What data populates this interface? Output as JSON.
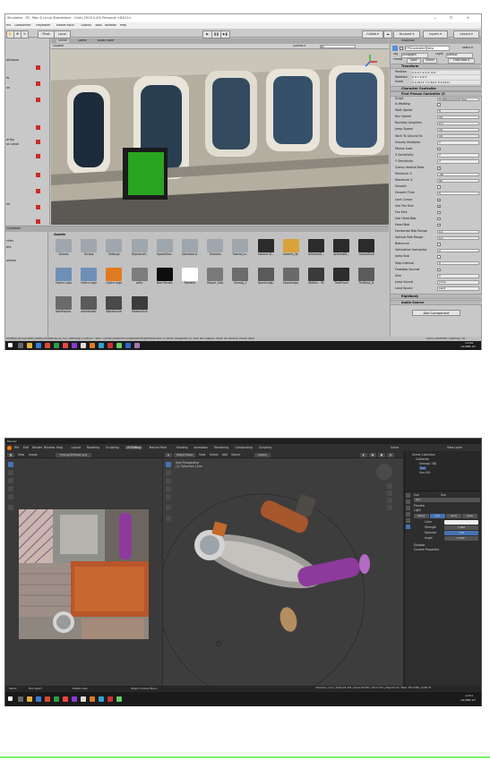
{
  "unity": {
    "title": "Simulator - PC, Mac & Linux Standalone - Unity 2019.2.4f1 Personal <DX11>",
    "window_controls": [
      "—",
      "☐",
      "✕"
    ],
    "menu": [
      "ect",
      "Component",
      "PlayMaker",
      "Mobile Input",
      "Tutorial",
      "Tools",
      "Window",
      "Help"
    ],
    "toolbar": {
      "pivot": "Pivot",
      "local": "Local",
      "collab": "Collab ▾",
      "account": "Account ▾",
      "layers": "Layers ▾",
      "layout": "Layout ▾"
    },
    "hierarchy": {
      "items": [
        "ellowpe",
        "ts",
        "ss",
        "erlay",
        "ss Level",
        "ne"
      ],
      "badge": "F"
    },
    "scene": {
      "tabs": [
        "Scene",
        "Game",
        "Asset Store"
      ],
      "shading": "Shaded",
      "gizmos": "Gizmos ▾",
      "search": "All"
    },
    "project": {
      "tab_left": "PlayMaker",
      "tree": [
        "rites",
        "ets",
        "utions"
      ],
      "header": "Assets",
      "assets_row1": [
        "Scenes",
        "Scripts",
        "Settings",
        "ShipsAndS...",
        "SpaceShac...",
        "Standard A...",
        "Textures",
        "Tutorial_In...",
        "Artemis B...",
        "Artemis_W...",
        "ArtemisSt...",
        "ArtemisSt...",
        "CockpitCall..."
      ],
      "assets_row2": [
        "Hydra Logo",
        "Hydra Logo...",
        "Hydra Logo...",
        "Lefty",
        "New Rende...",
        "Readme",
        "Repair_Stat...",
        "Smoog_1",
        "SpaceLega...",
        "SpaceLega...",
        "Station - St...",
        "TaskFluxx",
        "TheBoss_B..."
      ],
      "assets_row3": [
        "warehouse...",
        "warehouse...",
        "WarehouseD...",
        "ZeldersVizV"
      ]
    },
    "inspector": {
      "tab": "Inspector",
      "object_name": "FPSController@ship",
      "static": "Static ▾",
      "tag_label": "Tag",
      "tag_value": "Untagged",
      "layer_label": "Layer",
      "layer_value": "Default",
      "prefab_buttons": [
        "Prefab",
        "Open",
        "Select",
        "Overrides ▾"
      ],
      "transform": {
        "title": "Transform",
        "position": "X  0.4  Y  1.2  Z  -0.8",
        "rotation": "X  0    Y  0    Z  0",
        "scale": "X  0.4111  Y  0.4111  Z  0.4111",
        "labels": [
          "Position",
          "Rotation",
          "Scale"
        ]
      },
      "character_controller": "Character Controller",
      "fpc_title": "First Person Controller (S",
      "script_value": "FirstPersonController",
      "fields": [
        {
          "k": "Is Walking",
          "v": ""
        },
        {
          "k": "Walk Speed",
          "v": "5"
        },
        {
          "k": "Run Speed",
          "v": "10"
        },
        {
          "k": "Runstep Lengthen",
          "v": "0.7"
        },
        {
          "k": "Jump Speed",
          "v": "10"
        },
        {
          "k": "Stick To Ground Fo",
          "v": "10"
        },
        {
          "k": "Gravity Multiplier",
          "v": "2"
        },
        {
          "k": "Mouse Look",
          "v": ""
        },
        {
          "k": "X Sensitivity",
          "v": "2"
        },
        {
          "k": "Y Sensitivity",
          "v": "2"
        },
        {
          "k": "Clamp Vertical Rota",
          "v": "✓"
        },
        {
          "k": "Minimum X",
          "v": "-90"
        },
        {
          "k": "Maximum X",
          "v": "90"
        },
        {
          "k": "Smooth",
          "v": ""
        },
        {
          "k": "Smooth Time",
          "v": "5"
        },
        {
          "k": "Lock Cursor",
          "v": "✓"
        },
        {
          "k": "Use Fov Kick",
          "v": "✓"
        },
        {
          "k": "Fov Kick",
          "v": ""
        },
        {
          "k": "Use Head Bob",
          "v": ""
        },
        {
          "k": "Head Bob",
          "v": ""
        },
        {
          "k": "Horizontal Bob Range",
          "v": "0.1"
        },
        {
          "k": "Vertical Bob Range",
          "v": "0.1"
        },
        {
          "k": "Bobcurve",
          "v": ""
        },
        {
          "k": "Verticaltox Horizontal",
          "v": "2"
        },
        {
          "k": "Jump Bob",
          "v": ""
        },
        {
          "k": "Step Interval",
          "v": "5"
        },
        {
          "k": "Footstep Sounds",
          "v": ""
        },
        {
          "k": "Size",
          "v": "2"
        },
        {
          "k": "Jump Sound",
          "v": "Jump"
        },
        {
          "k": "Land Sound",
          "v": "Land"
        }
      ],
      "rigidbody": "Rigidbody",
      "audio_source": "Audio Source",
      "add_component": "Add Component"
    },
    "status_text": "ended\\Carl\\Scripts\\Cards\\ControlUs(38,30): warning CS0649: Field 'CardsController.ShipWhenTargetReached' is never assigned to, and will always have its default value false",
    "status_right": "Auto Generate Lighting Off",
    "taskbar": {
      "time": "11:44",
      "date": "14-Nov-19"
    }
  },
  "blender": {
    "title": "Blender",
    "menu": [
      "File",
      "Edit",
      "Render",
      "Window",
      "Help"
    ],
    "workspaces": [
      "Layout",
      "Modeling",
      "Sculpting",
      "UV Editing",
      "Texture Paint",
      "Shading",
      "Animation",
      "Rendering",
      "Compositing",
      "Scripting"
    ],
    "active_workspace": "UV Editing",
    "scene_label": "Scene",
    "view_layer": "View Layer",
    "uv_header": {
      "view": "View",
      "image": "Image",
      "filename": "Smoog1Diffuse1.png"
    },
    "viewport_header": {
      "mode": "Object Mode",
      "view": "View",
      "select": "Select",
      "add": "Add",
      "object": "Object",
      "global": "Global"
    },
    "viewport_overlay": [
      "User Perspective",
      "(1) Collection | Sun"
    ],
    "outliner": {
      "title": "Scene Collection",
      "items": [
        "Collection",
        "Smoog1 OBJ",
        "Sun",
        "Sun.001"
      ]
    },
    "properties": {
      "object": "Sun",
      "data": "Sun",
      "sections": [
        "Preview",
        "Light"
      ],
      "light_types": [
        "Point",
        "Sun",
        "Spot",
        "Area"
      ],
      "active_light_type": "Sun",
      "fields": [
        {
          "k": "Color",
          "v": ""
        },
        {
          "k": "Strength",
          "v": "3.000"
        },
        {
          "k": "Specular",
          "v": "1.00"
        },
        {
          "k": "Angle",
          "v": "0.526°"
        }
      ],
      "subsections": [
        "Shadow",
        "Custom Properties"
      ]
    },
    "status": {
      "left": [
        "Select",
        "Box Select",
        "Rotate View",
        "Object Context Menu"
      ],
      "right": "Collection | Sun | Verts:0/5,199 | Faces:0/4,852 | Tris:9,724 | Objects:1/3 | Mem: 58.0 MiB | v2.80.75"
    },
    "taskbar": {
      "time": "11:41",
      "date": "14-Nov-19"
    }
  },
  "colors": {
    "green_box": "#2aa51f",
    "unity_chrome": "#c2c2c2",
    "blender_bg": "#2b2b2b",
    "accent_line": "#7af06a",
    "blender_active": "#4772b3"
  }
}
